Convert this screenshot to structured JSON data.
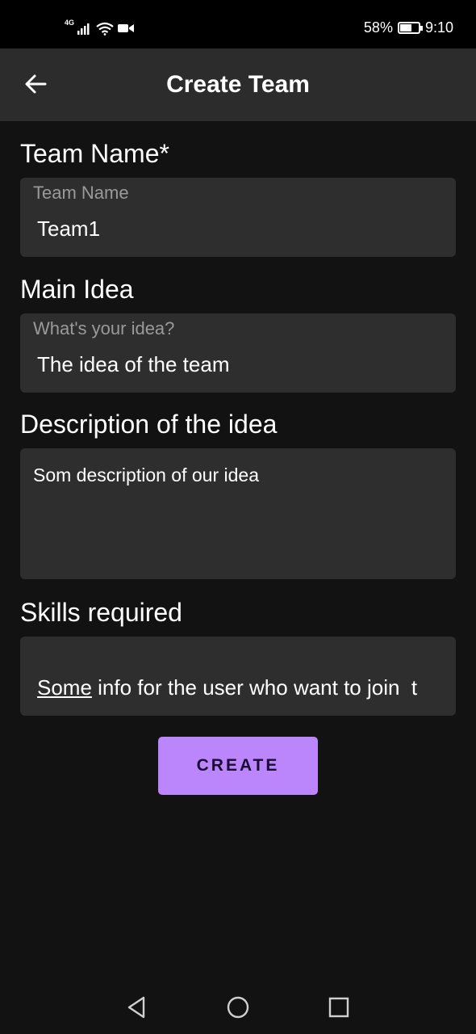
{
  "status_bar": {
    "network": "4G",
    "battery_percent": "58%",
    "battery_level": 0.58,
    "time": "9:10"
  },
  "app_bar": {
    "title": "Create Team",
    "back_icon": "arrow-left-icon"
  },
  "form": {
    "team_name": {
      "label": "Team Name*",
      "hint": "Team Name",
      "value": "Team1"
    },
    "main_idea": {
      "label": "Main Idea",
      "hint": "What's your idea?",
      "value": "The idea of the team"
    },
    "description": {
      "label": "Description of the idea",
      "value": "Som description of our idea"
    },
    "skills": {
      "label": "Skills required",
      "value_underlined": "Some",
      "value_rest": " info for the user who want to join  t"
    },
    "create_label": "CREATE"
  },
  "nav_bar": {
    "back_icon": "triangle-back-icon",
    "home_icon": "circle-home-icon",
    "recents_icon": "square-recents-icon"
  },
  "colors": {
    "background": "#121212",
    "app_bar": "#2c2c2c",
    "field": "#2e2e2e",
    "accent": "#bb86fc"
  }
}
